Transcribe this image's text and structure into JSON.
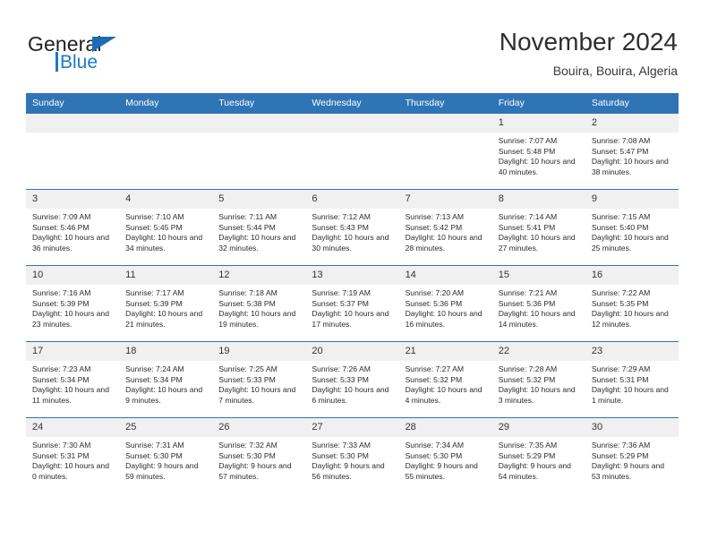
{
  "brand": {
    "name_top": "General",
    "name_bottom": "Blue",
    "flag_color": "#1b6cb3",
    "blue_color": "#1b7ac4"
  },
  "header": {
    "month_title": "November 2024",
    "location": "Bouira, Bouira, Algeria"
  },
  "theme": {
    "header_blue": "#2f74b5",
    "daynum_gray": "#f0f0f0",
    "text": "#2b2b2b"
  },
  "calendar": {
    "weekdays": [
      "Sunday",
      "Monday",
      "Tuesday",
      "Wednesday",
      "Thursday",
      "Friday",
      "Saturday"
    ],
    "weeks": [
      [
        {
          "day": "",
          "sunrise": "",
          "sunset": "",
          "daylight": ""
        },
        {
          "day": "",
          "sunrise": "",
          "sunset": "",
          "daylight": ""
        },
        {
          "day": "",
          "sunrise": "",
          "sunset": "",
          "daylight": ""
        },
        {
          "day": "",
          "sunrise": "",
          "sunset": "",
          "daylight": ""
        },
        {
          "day": "",
          "sunrise": "",
          "sunset": "",
          "daylight": ""
        },
        {
          "day": "1",
          "sunrise": "Sunrise: 7:07 AM",
          "sunset": "Sunset: 5:48 PM",
          "daylight": "Daylight: 10 hours and 40 minutes."
        },
        {
          "day": "2",
          "sunrise": "Sunrise: 7:08 AM",
          "sunset": "Sunset: 5:47 PM",
          "daylight": "Daylight: 10 hours and 38 minutes."
        }
      ],
      [
        {
          "day": "3",
          "sunrise": "Sunrise: 7:09 AM",
          "sunset": "Sunset: 5:46 PM",
          "daylight": "Daylight: 10 hours and 36 minutes."
        },
        {
          "day": "4",
          "sunrise": "Sunrise: 7:10 AM",
          "sunset": "Sunset: 5:45 PM",
          "daylight": "Daylight: 10 hours and 34 minutes."
        },
        {
          "day": "5",
          "sunrise": "Sunrise: 7:11 AM",
          "sunset": "Sunset: 5:44 PM",
          "daylight": "Daylight: 10 hours and 32 minutes."
        },
        {
          "day": "6",
          "sunrise": "Sunrise: 7:12 AM",
          "sunset": "Sunset: 5:43 PM",
          "daylight": "Daylight: 10 hours and 30 minutes."
        },
        {
          "day": "7",
          "sunrise": "Sunrise: 7:13 AM",
          "sunset": "Sunset: 5:42 PM",
          "daylight": "Daylight: 10 hours and 28 minutes."
        },
        {
          "day": "8",
          "sunrise": "Sunrise: 7:14 AM",
          "sunset": "Sunset: 5:41 PM",
          "daylight": "Daylight: 10 hours and 27 minutes."
        },
        {
          "day": "9",
          "sunrise": "Sunrise: 7:15 AM",
          "sunset": "Sunset: 5:40 PM",
          "daylight": "Daylight: 10 hours and 25 minutes."
        }
      ],
      [
        {
          "day": "10",
          "sunrise": "Sunrise: 7:16 AM",
          "sunset": "Sunset: 5:39 PM",
          "daylight": "Daylight: 10 hours and 23 minutes."
        },
        {
          "day": "11",
          "sunrise": "Sunrise: 7:17 AM",
          "sunset": "Sunset: 5:39 PM",
          "daylight": "Daylight: 10 hours and 21 minutes."
        },
        {
          "day": "12",
          "sunrise": "Sunrise: 7:18 AM",
          "sunset": "Sunset: 5:38 PM",
          "daylight": "Daylight: 10 hours and 19 minutes."
        },
        {
          "day": "13",
          "sunrise": "Sunrise: 7:19 AM",
          "sunset": "Sunset: 5:37 PM",
          "daylight": "Daylight: 10 hours and 17 minutes."
        },
        {
          "day": "14",
          "sunrise": "Sunrise: 7:20 AM",
          "sunset": "Sunset: 5:36 PM",
          "daylight": "Daylight: 10 hours and 16 minutes."
        },
        {
          "day": "15",
          "sunrise": "Sunrise: 7:21 AM",
          "sunset": "Sunset: 5:36 PM",
          "daylight": "Daylight: 10 hours and 14 minutes."
        },
        {
          "day": "16",
          "sunrise": "Sunrise: 7:22 AM",
          "sunset": "Sunset: 5:35 PM",
          "daylight": "Daylight: 10 hours and 12 minutes."
        }
      ],
      [
        {
          "day": "17",
          "sunrise": "Sunrise: 7:23 AM",
          "sunset": "Sunset: 5:34 PM",
          "daylight": "Daylight: 10 hours and 11 minutes."
        },
        {
          "day": "18",
          "sunrise": "Sunrise: 7:24 AM",
          "sunset": "Sunset: 5:34 PM",
          "daylight": "Daylight: 10 hours and 9 minutes."
        },
        {
          "day": "19",
          "sunrise": "Sunrise: 7:25 AM",
          "sunset": "Sunset: 5:33 PM",
          "daylight": "Daylight: 10 hours and 7 minutes."
        },
        {
          "day": "20",
          "sunrise": "Sunrise: 7:26 AM",
          "sunset": "Sunset: 5:33 PM",
          "daylight": "Daylight: 10 hours and 6 minutes."
        },
        {
          "day": "21",
          "sunrise": "Sunrise: 7:27 AM",
          "sunset": "Sunset: 5:32 PM",
          "daylight": "Daylight: 10 hours and 4 minutes."
        },
        {
          "day": "22",
          "sunrise": "Sunrise: 7:28 AM",
          "sunset": "Sunset: 5:32 PM",
          "daylight": "Daylight: 10 hours and 3 minutes."
        },
        {
          "day": "23",
          "sunrise": "Sunrise: 7:29 AM",
          "sunset": "Sunset: 5:31 PM",
          "daylight": "Daylight: 10 hours and 1 minute."
        }
      ],
      [
        {
          "day": "24",
          "sunrise": "Sunrise: 7:30 AM",
          "sunset": "Sunset: 5:31 PM",
          "daylight": "Daylight: 10 hours and 0 minutes."
        },
        {
          "day": "25",
          "sunrise": "Sunrise: 7:31 AM",
          "sunset": "Sunset: 5:30 PM",
          "daylight": "Daylight: 9 hours and 59 minutes."
        },
        {
          "day": "26",
          "sunrise": "Sunrise: 7:32 AM",
          "sunset": "Sunset: 5:30 PM",
          "daylight": "Daylight: 9 hours and 57 minutes."
        },
        {
          "day": "27",
          "sunrise": "Sunrise: 7:33 AM",
          "sunset": "Sunset: 5:30 PM",
          "daylight": "Daylight: 9 hours and 56 minutes."
        },
        {
          "day": "28",
          "sunrise": "Sunrise: 7:34 AM",
          "sunset": "Sunset: 5:30 PM",
          "daylight": "Daylight: 9 hours and 55 minutes."
        },
        {
          "day": "29",
          "sunrise": "Sunrise: 7:35 AM",
          "sunset": "Sunset: 5:29 PM",
          "daylight": "Daylight: 9 hours and 54 minutes."
        },
        {
          "day": "30",
          "sunrise": "Sunrise: 7:36 AM",
          "sunset": "Sunset: 5:29 PM",
          "daylight": "Daylight: 9 hours and 53 minutes."
        }
      ]
    ]
  }
}
